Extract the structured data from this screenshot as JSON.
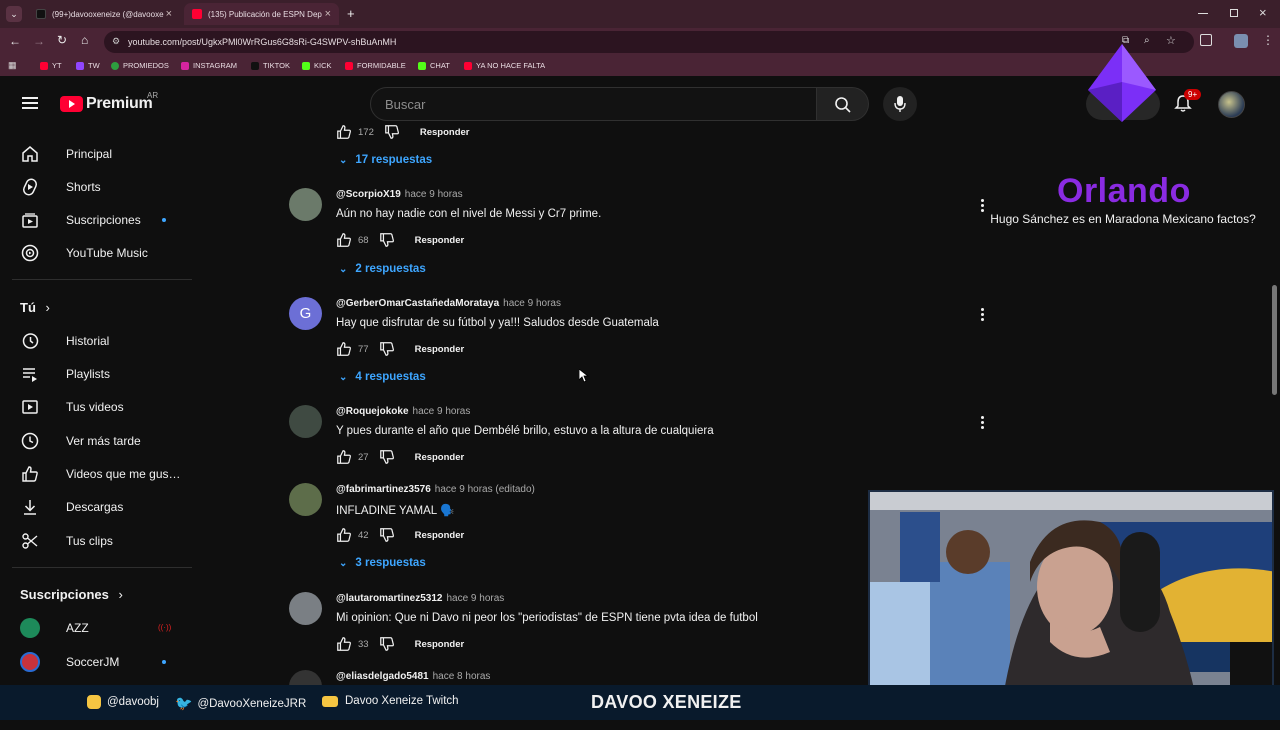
{
  "browser": {
    "tabs": [
      {
        "title": "(99+)davooxeneize (@davooxe"
      },
      {
        "title": "(135) Publicación de ESPN Dep"
      }
    ],
    "new_tab": "+",
    "url": "youtube.com/post/UgkxPMl0WrRGus6G8sRi-G4SWPV-shBuAnMH",
    "bookmarks": [
      "YT",
      "TW",
      "PROMIEDOS",
      "INSTAGRAM",
      "TIKTOK",
      "KICK",
      "FORMIDABLE",
      "CHAT",
      "YA NO HACE FALTA"
    ]
  },
  "masthead": {
    "logo_text": "Premium",
    "country": "AR",
    "search_placeholder": "Buscar",
    "notif_badge": "9+"
  },
  "sidebar": {
    "main": [
      {
        "label": "Principal",
        "icon": "home-icon"
      },
      {
        "label": "Shorts",
        "icon": "shorts-icon"
      },
      {
        "label": "Suscripciones",
        "icon": "subscriptions-icon"
      },
      {
        "label": "YouTube Music",
        "icon": "music-icon"
      }
    ],
    "you_header": "Tú",
    "you": [
      {
        "label": "Historial",
        "icon": "history-icon"
      },
      {
        "label": "Playlists",
        "icon": "playlists-icon"
      },
      {
        "label": "Tus videos",
        "icon": "your-videos-icon"
      },
      {
        "label": "Ver más tarde",
        "icon": "watch-later-icon"
      },
      {
        "label": "Videos que me gus…",
        "icon": "liked-icon"
      },
      {
        "label": "Descargas",
        "icon": "downloads-icon"
      },
      {
        "label": "Tus clips",
        "icon": "clips-icon"
      }
    ],
    "subs_header": "Suscripciones",
    "subs": [
      {
        "label": "AZZ",
        "badge": "live"
      },
      {
        "label": "SoccerJM",
        "badge": "dot"
      }
    ]
  },
  "comments": {
    "top_actions": {
      "likes": "172",
      "reply": "Responder"
    },
    "top_replies": "17 respuestas",
    "items": [
      {
        "author": "@ScorpioX19",
        "time": "hace 9 horas",
        "text": "Aún no hay nadie con el nivel de Messi y Cr7 prime.",
        "likes": "68",
        "reply": "Responder",
        "replies": "2 respuestas"
      },
      {
        "author": "@GerberOmarCastañedaMorataya",
        "time": "hace 9 horas",
        "text": "Hay que disfrutar de su fútbol y ya!!! Saludos desde Guatemala",
        "likes": "77",
        "reply": "Responder",
        "replies": "4 respuestas",
        "initial": "G"
      },
      {
        "author": "@Roquejokoke",
        "time": "hace 9 horas",
        "text": "Y pues durante el año que Dembélé brillo, estuvo a la altura de cualquiera",
        "likes": "27",
        "reply": "Responder"
      },
      {
        "author": "@fabrimartinez3576",
        "time": "hace 9 horas (editado)",
        "text": "INFLADINE YAMAL 🗣️",
        "likes": "42",
        "reply": "Responder",
        "replies": "3 respuestas"
      },
      {
        "author": "@lautaromartinez5312",
        "time": "hace 9 horas",
        "text": "Mi opinion: Que ni Davo ni peor los \"periodistas\" de ESPN tiene pvta idea de futbol",
        "likes": "33",
        "reply": "Responder"
      },
      {
        "author": "@eliasdelgado5481",
        "time": "hace 8 horas"
      }
    ]
  },
  "overlay": {
    "name": "Orlando",
    "message": "Hugo Sánchez es en Maradona Mexicano factos?"
  },
  "bottombar": {
    "instagram": "@davoobj",
    "twitter": "@DavooXeneizeJRR",
    "youtube": "Davoo Xeneize Twitch",
    "brand": "DAVOO XENEIZE"
  },
  "colors": {
    "accent": "#3ea6ff",
    "overlay_name": "#8a2be2",
    "yt_red": "#ff0033"
  }
}
